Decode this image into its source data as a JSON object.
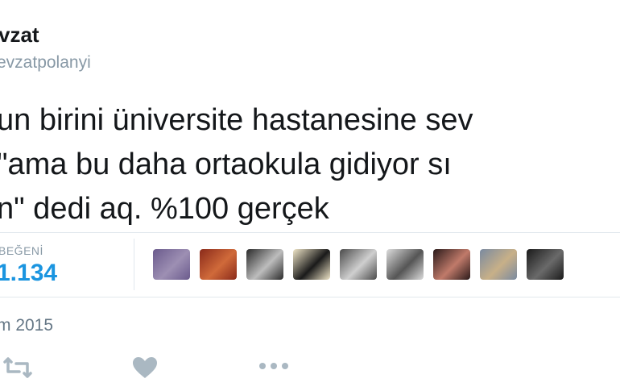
{
  "tweet": {
    "display_name": "vzat",
    "handle": "evzatpolanyi",
    "text_lines": [
      "un birini üniversite hastanesine sev",
      "\"ama bu daha ortaokula gidiyor sı",
      "n\" dedi aq. %100 gerçek"
    ],
    "likes_label": "BEĞENİ",
    "likes_count": "1.134",
    "date": "m 2015"
  },
  "liker_avatars": [
    {
      "name": "liker-avatar-1",
      "colors": [
        "#6a5a8c",
        "#9d8fb3"
      ]
    },
    {
      "name": "liker-avatar-2",
      "colors": [
        "#8a2a1a",
        "#d06a3a"
      ]
    },
    {
      "name": "liker-avatar-3",
      "colors": [
        "#2a2a2a",
        "#bdbdbd"
      ]
    },
    {
      "name": "liker-avatar-4",
      "colors": [
        "#f0e6c8",
        "#1a1a1a"
      ]
    },
    {
      "name": "liker-avatar-5",
      "colors": [
        "#4a4a4a",
        "#cfcfcf"
      ]
    },
    {
      "name": "liker-avatar-6",
      "colors": [
        "#dcdcdc",
        "#555555"
      ]
    },
    {
      "name": "liker-avatar-7",
      "colors": [
        "#2a1a1a",
        "#c07a6a"
      ]
    },
    {
      "name": "liker-avatar-8",
      "colors": [
        "#7a8aa0",
        "#c8b088"
      ]
    },
    {
      "name": "liker-avatar-9",
      "colors": [
        "#1a1a1a",
        "#6a6a6a"
      ]
    }
  ],
  "icons": {
    "retweet": "retweet-icon",
    "like": "heart-icon",
    "more": "more-dots-icon"
  },
  "colors": {
    "accent": "#1b95e0",
    "secondary": "#8899a6",
    "icon": "#aab8c2"
  }
}
